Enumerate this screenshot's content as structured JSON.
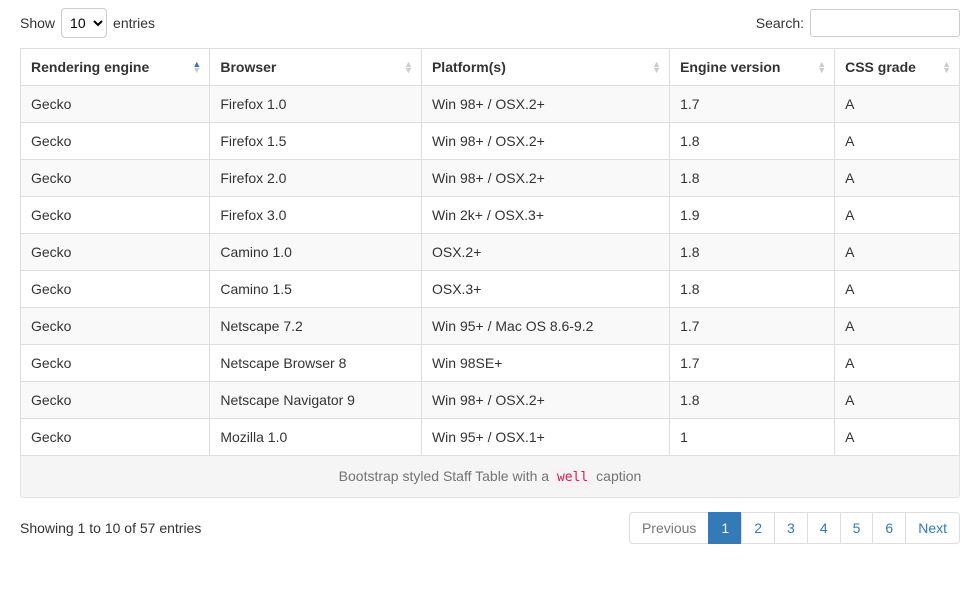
{
  "controls": {
    "show_label_pre": "Show",
    "show_label_post": "entries",
    "show_value": "10",
    "search_label": "Search:"
  },
  "table": {
    "headers": [
      "Rendering engine",
      "Browser",
      "Platform(s)",
      "Engine version",
      "CSS grade"
    ],
    "sorted_col": 0,
    "rows": [
      [
        "Gecko",
        "Firefox 1.0",
        "Win 98+ / OSX.2+",
        "1.7",
        "A"
      ],
      [
        "Gecko",
        "Firefox 1.5",
        "Win 98+ / OSX.2+",
        "1.8",
        "A"
      ],
      [
        "Gecko",
        "Firefox 2.0",
        "Win 98+ / OSX.2+",
        "1.8",
        "A"
      ],
      [
        "Gecko",
        "Firefox 3.0",
        "Win 2k+ / OSX.3+",
        "1.9",
        "A"
      ],
      [
        "Gecko",
        "Camino 1.0",
        "OSX.2+",
        "1.8",
        "A"
      ],
      [
        "Gecko",
        "Camino 1.5",
        "OSX.3+",
        "1.8",
        "A"
      ],
      [
        "Gecko",
        "Netscape 7.2",
        "Win 95+ / Mac OS 8.6-9.2",
        "1.7",
        "A"
      ],
      [
        "Gecko",
        "Netscape Browser 8",
        "Win 98SE+",
        "1.7",
        "A"
      ],
      [
        "Gecko",
        "Netscape Navigator 9",
        "Win 98+ / OSX.2+",
        "1.8",
        "A"
      ],
      [
        "Gecko",
        "Mozilla 1.0",
        "Win 95+ / OSX.1+",
        "1",
        "A"
      ]
    ]
  },
  "caption": {
    "pre": "Bootstrap styled Staff Table with a ",
    "code": "well",
    "post": " caption"
  },
  "info": "Showing 1 to 10 of 57 entries",
  "pagination": {
    "prev": "Previous",
    "next": "Next",
    "pages": [
      "1",
      "2",
      "3",
      "4",
      "5",
      "6"
    ],
    "active": "1",
    "prev_disabled": true
  }
}
